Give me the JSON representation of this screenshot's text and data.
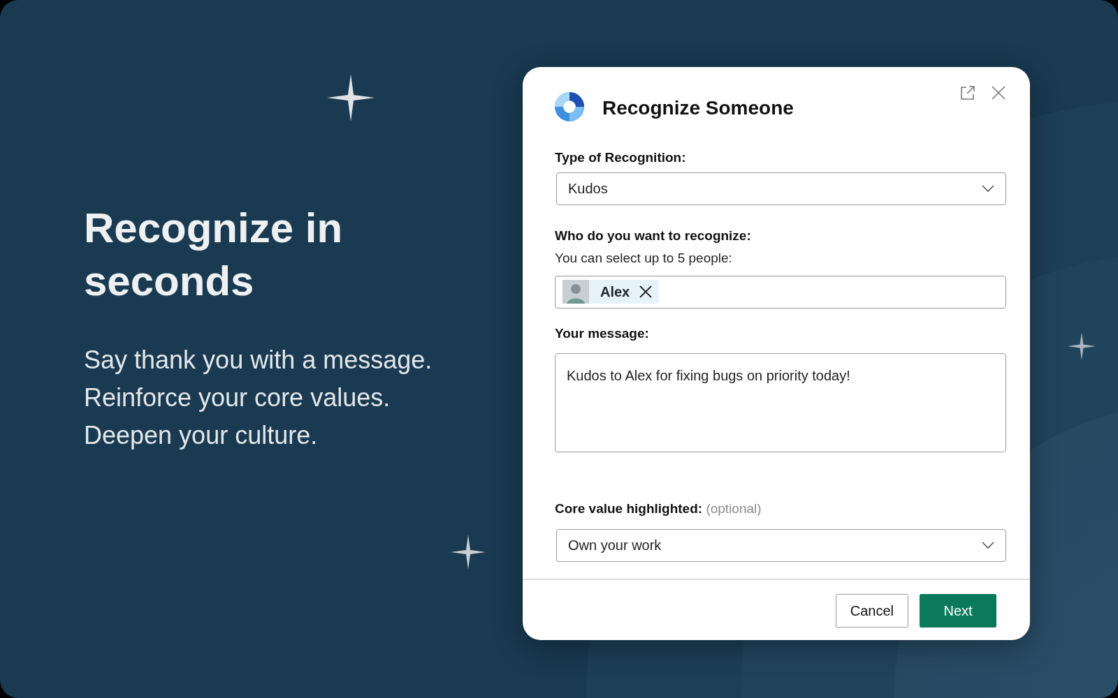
{
  "hero": {
    "heading": "Recognize in seconds",
    "lines": [
      "Say thank you with a message.",
      "Reinforce your core values.",
      "Deepen your culture."
    ]
  },
  "dialog": {
    "title": "Recognize Someone",
    "type_field": {
      "label": "Type of Recognition:",
      "value": "Kudos"
    },
    "recipients_field": {
      "label": "Who do you want to recognize:",
      "hint": "You can select up to 5 people:",
      "chips": [
        {
          "name": "Alex"
        }
      ]
    },
    "message_field": {
      "label": "Your message:",
      "value": "Kudos to Alex for fixing bugs on priority today!"
    },
    "core_value_field": {
      "label": "Core value highlighted:",
      "note": "(optional)",
      "value": "Own your work"
    },
    "buttons": [
      {
        "label": "Cancel",
        "kind": "secondary"
      },
      {
        "label": "Next",
        "kind": "primary"
      }
    ]
  }
}
